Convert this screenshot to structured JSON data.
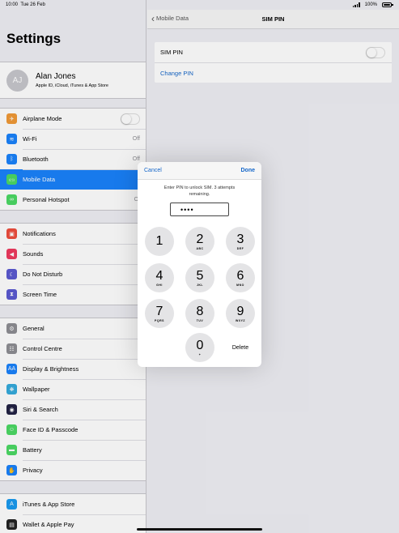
{
  "status": {
    "time": "10:00",
    "date": "Tue 26 Feb",
    "battery": "100%"
  },
  "settings": {
    "title": "Settings",
    "profile": {
      "initials": "AJ",
      "name": "Alan Jones",
      "sub": "Apple ID, iCloud, iTunes & App Store"
    },
    "group1": [
      {
        "label": "Airplane Mode",
        "icon": "airplane-icon",
        "color": "#f19a37",
        "glyph": "✈"
      },
      {
        "label": "Wi-Fi",
        "value": "Off",
        "icon": "wifi-icon",
        "color": "#1a82fb",
        "glyph": "≋"
      },
      {
        "label": "Bluetooth",
        "value": "Off",
        "icon": "bluetooth-icon",
        "color": "#1a82fb",
        "glyph": "ᛒ"
      },
      {
        "label": "Mobile Data",
        "icon": "antenna-icon",
        "color": "#4cd964",
        "glyph": "((·))"
      },
      {
        "label": "Personal Hotspot",
        "value": "Of",
        "icon": "hotspot-icon",
        "color": "#4cd964",
        "glyph": "∞"
      }
    ],
    "group2": [
      {
        "label": "Notifications",
        "icon": "notifications-icon",
        "color": "#ee4d3d",
        "glyph": "▣"
      },
      {
        "label": "Sounds",
        "icon": "speaker-icon",
        "color": "#ee3a5e",
        "glyph": "◀"
      },
      {
        "label": "Do Not Disturb",
        "icon": "moon-icon",
        "color": "#5b5ad1",
        "glyph": "☾"
      },
      {
        "label": "Screen Time",
        "icon": "hourglass-icon",
        "color": "#5b5ad1",
        "glyph": "⧗"
      }
    ],
    "group3": [
      {
        "label": "General",
        "icon": "gear-icon",
        "color": "#8e8e93",
        "glyph": "⚙"
      },
      {
        "label": "Control Centre",
        "icon": "switches-icon",
        "color": "#8e8e93",
        "glyph": "☷"
      },
      {
        "label": "Display & Brightness",
        "icon": "text-size-icon",
        "color": "#1a82fb",
        "glyph": "AA"
      },
      {
        "label": "Wallpaper",
        "icon": "flower-icon",
        "color": "#35aadc",
        "glyph": "❋"
      },
      {
        "label": "Siri & Search",
        "icon": "siri-icon",
        "color": "#222244",
        "glyph": "◉"
      },
      {
        "label": "Face ID & Passcode",
        "icon": "face-id-icon",
        "color": "#4cd964",
        "glyph": "☺"
      },
      {
        "label": "Battery",
        "icon": "battery-icon",
        "color": "#4cd964",
        "glyph": "▬"
      },
      {
        "label": "Privacy",
        "icon": "hand-icon",
        "color": "#1a82fb",
        "glyph": "✋"
      }
    ],
    "group4": [
      {
        "label": "iTunes & App Store",
        "icon": "app-store-icon",
        "color": "#1a9bf0",
        "glyph": "A"
      },
      {
        "label": "Wallet & Apple Pay",
        "icon": "wallet-icon",
        "color": "#222",
        "glyph": "▤"
      }
    ]
  },
  "detail": {
    "back_label": "Mobile Data",
    "title": "SIM PIN",
    "sim_pin_label": "SIM PIN",
    "change_pin_label": "Change PIN"
  },
  "pin_dialog": {
    "cancel": "Cancel",
    "done": "Done",
    "message": "Enter PIN to unlock SIM. 3 attempts remaining.",
    "pin_value": "••••",
    "delete": "Delete",
    "keys": [
      {
        "num": "1",
        "letters": ""
      },
      {
        "num": "2",
        "letters": "ABC"
      },
      {
        "num": "3",
        "letters": "DEF"
      },
      {
        "num": "4",
        "letters": "GHI"
      },
      {
        "num": "5",
        "letters": "JKL"
      },
      {
        "num": "6",
        "letters": "MNO"
      },
      {
        "num": "7",
        "letters": "PQRS"
      },
      {
        "num": "8",
        "letters": "TUV"
      },
      {
        "num": "9",
        "letters": "WXYZ"
      },
      {
        "num": "0",
        "letters": "+"
      }
    ]
  }
}
